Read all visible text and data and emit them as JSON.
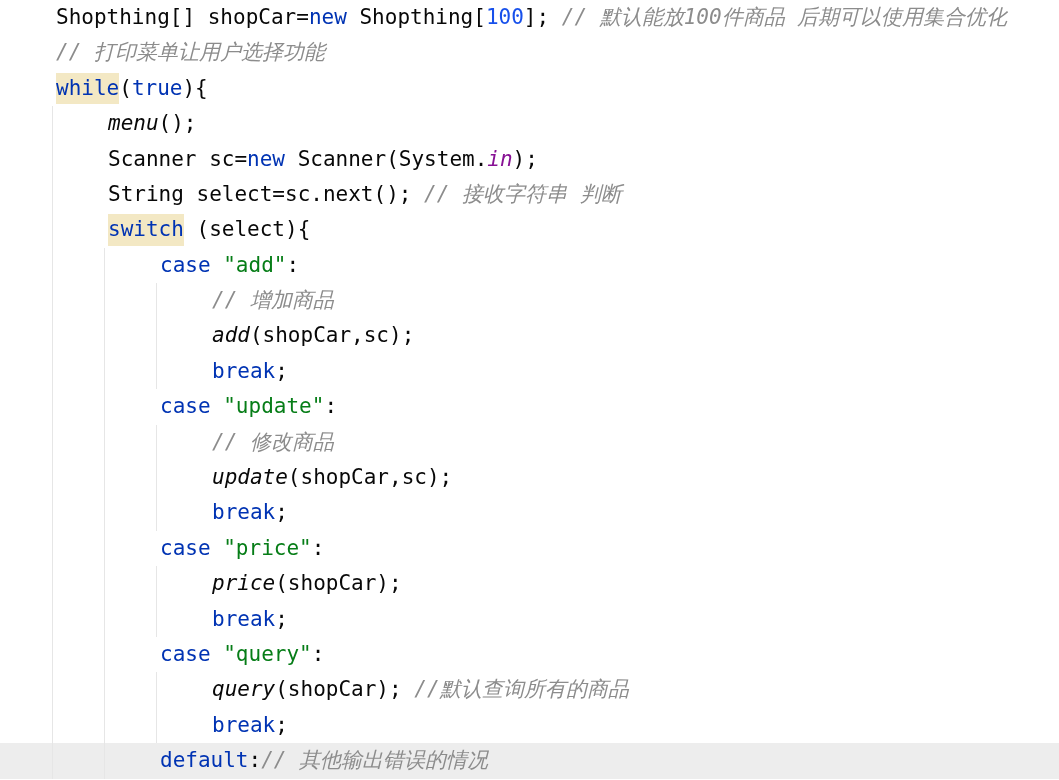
{
  "lines": [
    {
      "tokens": [
        {
          "kind": "plain",
          "text": "Shopthing[] shopCar="
        },
        {
          "kind": "keyword",
          "text": "new"
        },
        {
          "kind": "plain",
          "text": " Shopthing["
        },
        {
          "kind": "number",
          "text": "100"
        },
        {
          "kind": "plain",
          "text": "]; "
        },
        {
          "kind": "comment",
          "text": "// 默认能放100件商品 后期可以使用集合优化"
        }
      ]
    },
    {
      "tokens": [
        {
          "kind": "comment",
          "text": "// 打印菜单让用户选择功能"
        }
      ]
    },
    {
      "tokens": [
        {
          "kind": "keyword",
          "text": "while",
          "highlight": true
        },
        {
          "kind": "plain",
          "text": "("
        },
        {
          "kind": "keyword",
          "text": "true"
        },
        {
          "kind": "plain",
          "text": "){"
        }
      ],
      "children": [
        {
          "tokens": [
            {
              "kind": "method",
              "text": "menu"
            },
            {
              "kind": "plain",
              "text": "();"
            }
          ]
        },
        {
          "tokens": [
            {
              "kind": "plain",
              "text": "Scanner sc="
            },
            {
              "kind": "keyword",
              "text": "new"
            },
            {
              "kind": "plain",
              "text": " Scanner(System."
            },
            {
              "kind": "field",
              "text": "in"
            },
            {
              "kind": "plain",
              "text": ");"
            }
          ]
        },
        {
          "tokens": [
            {
              "kind": "plain",
              "text": "String select=sc.next(); "
            },
            {
              "kind": "comment",
              "text": "// 接收字符串 判断"
            }
          ]
        },
        {
          "tokens": [
            {
              "kind": "keyword",
              "text": "switch",
              "highlight": true
            },
            {
              "kind": "plain",
              "text": " (select){"
            }
          ],
          "children": [
            {
              "tokens": [
                {
                  "kind": "keyword",
                  "text": "case "
                },
                {
                  "kind": "string",
                  "text": "\"add\""
                },
                {
                  "kind": "plain",
                  "text": ":"
                }
              ],
              "children": [
                {
                  "tokens": [
                    {
                      "kind": "comment",
                      "text": "// 增加商品"
                    }
                  ]
                },
                {
                  "tokens": [
                    {
                      "kind": "method",
                      "text": "add"
                    },
                    {
                      "kind": "plain",
                      "text": "(shopCar,sc);"
                    }
                  ]
                },
                {
                  "tokens": [
                    {
                      "kind": "keyword",
                      "text": "break"
                    },
                    {
                      "kind": "plain",
                      "text": ";"
                    }
                  ]
                }
              ]
            },
            {
              "tokens": [
                {
                  "kind": "keyword",
                  "text": "case "
                },
                {
                  "kind": "string",
                  "text": "\"update\""
                },
                {
                  "kind": "plain",
                  "text": ":"
                }
              ],
              "children": [
                {
                  "tokens": [
                    {
                      "kind": "comment",
                      "text": "// 修改商品"
                    }
                  ]
                },
                {
                  "tokens": [
                    {
                      "kind": "method",
                      "text": "update"
                    },
                    {
                      "kind": "plain",
                      "text": "(shopCar,sc);"
                    }
                  ]
                },
                {
                  "tokens": [
                    {
                      "kind": "keyword",
                      "text": "break"
                    },
                    {
                      "kind": "plain",
                      "text": ";"
                    }
                  ]
                }
              ]
            },
            {
              "tokens": [
                {
                  "kind": "keyword",
                  "text": "case "
                },
                {
                  "kind": "string",
                  "text": "\"price\""
                },
                {
                  "kind": "plain",
                  "text": ":"
                }
              ],
              "children": [
                {
                  "tokens": [
                    {
                      "kind": "method",
                      "text": "price"
                    },
                    {
                      "kind": "plain",
                      "text": "(shopCar);"
                    }
                  ]
                },
                {
                  "tokens": [
                    {
                      "kind": "keyword",
                      "text": "break"
                    },
                    {
                      "kind": "plain",
                      "text": ";"
                    }
                  ]
                }
              ]
            },
            {
              "tokens": [
                {
                  "kind": "keyword",
                  "text": "case "
                },
                {
                  "kind": "string",
                  "text": "\"query\""
                },
                {
                  "kind": "plain",
                  "text": ":"
                }
              ],
              "children": [
                {
                  "tokens": [
                    {
                      "kind": "method",
                      "text": "query"
                    },
                    {
                      "kind": "plain",
                      "text": "(shopCar); "
                    },
                    {
                      "kind": "comment",
                      "text": "//默认查询所有的商品"
                    }
                  ]
                },
                {
                  "tokens": [
                    {
                      "kind": "keyword",
                      "text": "break"
                    },
                    {
                      "kind": "plain",
                      "text": ";"
                    }
                  ]
                }
              ]
            },
            {
              "current": true,
              "tokens": [
                {
                  "kind": "keyword",
                  "text": "default"
                },
                {
                  "kind": "plain",
                  "text": ":"
                },
                {
                  "kind": "comment",
                  "text": "// 其他输出错误的情况"
                }
              ]
            }
          ]
        }
      ]
    }
  ]
}
